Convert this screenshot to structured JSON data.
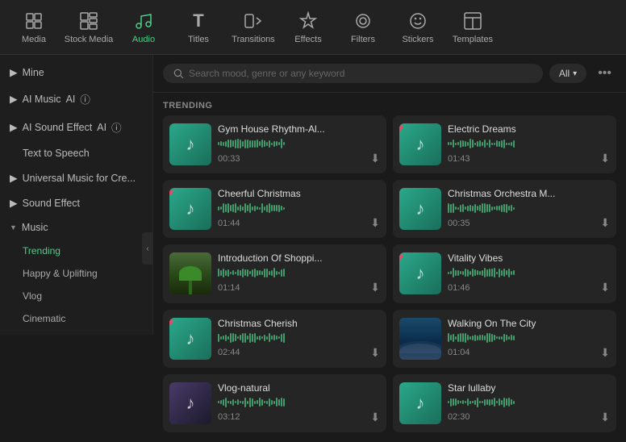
{
  "topnav": {
    "items": [
      {
        "id": "media",
        "label": "Media",
        "icon": "⊞",
        "active": false
      },
      {
        "id": "stock-media",
        "label": "Stock Media",
        "icon": "▦",
        "active": false
      },
      {
        "id": "audio",
        "label": "Audio",
        "icon": "♪",
        "active": true
      },
      {
        "id": "titles",
        "label": "Titles",
        "icon": "T",
        "active": false
      },
      {
        "id": "transitions",
        "label": "Transitions",
        "icon": "▷",
        "active": false
      },
      {
        "id": "effects",
        "label": "Effects",
        "icon": "✦",
        "active": false
      },
      {
        "id": "filters",
        "label": "Filters",
        "icon": "◎",
        "active": false
      },
      {
        "id": "stickers",
        "label": "Stickers",
        "icon": "☺",
        "active": false
      },
      {
        "id": "templates",
        "label": "Templates",
        "icon": "⊡",
        "active": false
      }
    ]
  },
  "sidebar": {
    "items": [
      {
        "id": "mine",
        "label": "Mine",
        "type": "collapsible",
        "expanded": false
      },
      {
        "id": "ai-music",
        "label": "AI Music",
        "type": "collapsible",
        "expanded": false,
        "badge": "AI",
        "info": true
      },
      {
        "id": "ai-sound-effect",
        "label": "AI Sound Effect",
        "type": "collapsible",
        "expanded": false,
        "badge": "AI",
        "info": true
      },
      {
        "id": "text-to-speech",
        "label": "Text to Speech",
        "type": "item",
        "expanded": false
      },
      {
        "id": "universal-music",
        "label": "Universal Music for Cre...",
        "type": "collapsible",
        "expanded": false
      },
      {
        "id": "sound-effect",
        "label": "Sound Effect",
        "type": "collapsible",
        "expanded": false
      },
      {
        "id": "music",
        "label": "Music",
        "type": "collapsible",
        "expanded": true
      }
    ],
    "music_sub": [
      {
        "id": "trending",
        "label": "Trending",
        "active": true
      },
      {
        "id": "happy-uplifting",
        "label": "Happy & Uplifting",
        "active": false
      },
      {
        "id": "vlog",
        "label": "Vlog",
        "active": false
      },
      {
        "id": "cinematic",
        "label": "Cinematic",
        "active": false
      }
    ]
  },
  "search": {
    "placeholder": "Search mood, genre or any keyword",
    "filter_label": "All",
    "more_icon": "•••"
  },
  "trending": {
    "label": "TRENDING",
    "items": [
      {
        "id": 1,
        "title": "Gym House Rhythm-Al...",
        "duration": "00:33",
        "thumb_type": "teal",
        "heart": false
      },
      {
        "id": 2,
        "title": "Electric Dreams",
        "duration": "01:43",
        "thumb_type": "teal",
        "heart": true
      },
      {
        "id": 3,
        "title": "Cheerful Christmas",
        "duration": "01:44",
        "thumb_type": "teal",
        "heart": true
      },
      {
        "id": 4,
        "title": "Christmas Orchestra M...",
        "duration": "00:35",
        "thumb_type": "teal",
        "heart": false
      },
      {
        "id": 5,
        "title": "Introduction Of Shoppi...",
        "duration": "01:14",
        "thumb_type": "beach",
        "heart": false
      },
      {
        "id": 6,
        "title": "Vitality Vibes",
        "duration": "01:46",
        "thumb_type": "teal",
        "heart": true
      },
      {
        "id": 7,
        "title": "Christmas Cherish",
        "duration": "02:44",
        "thumb_type": "teal",
        "heart": true
      },
      {
        "id": 8,
        "title": "Walking On The City",
        "duration": "01:04",
        "thumb_type": "water",
        "heart": false
      },
      {
        "id": 9,
        "title": "Vlog-natural",
        "duration": "03:12",
        "thumb_type": "purple",
        "heart": false
      },
      {
        "id": 10,
        "title": "Star lullaby",
        "duration": "02:30",
        "thumb_type": "teal",
        "heart": false
      }
    ]
  }
}
